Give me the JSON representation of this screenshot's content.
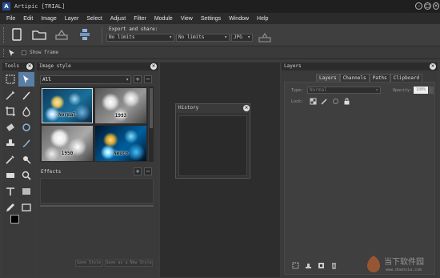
{
  "app": {
    "title": "Artipic [TRIAL]",
    "logo_letter": "A"
  },
  "window_controls": [
    "minimize",
    "maximize",
    "close"
  ],
  "menu": [
    "File",
    "Edit",
    "Image",
    "Layer",
    "Select",
    "Adjust",
    "Filter",
    "Module",
    "View",
    "Settings",
    "Window",
    "Help"
  ],
  "toolbar": {
    "export_label": "Export and share:",
    "export_size_1": "No limits",
    "export_size_2": "No limits",
    "export_format": "JPG"
  },
  "options_bar": {
    "show_frame": "Show frame"
  },
  "tools_panel": {
    "title": "Tools"
  },
  "image_style_panel": {
    "title": "Image style",
    "category": "All",
    "thumbnails": [
      "Normal",
      "1993",
      "1950",
      "Neuro"
    ],
    "effects_label": "Effects",
    "save_style": "Save Style",
    "save_new_style": "Save as a New Style"
  },
  "history_panel": {
    "title": "History"
  },
  "layers_panel": {
    "title": "Layers",
    "tabs": [
      "Layers",
      "Channels",
      "Paths",
      "Clipboard"
    ],
    "type_label": "Type:",
    "type_value": "Normal",
    "opacity_label": "Opacity:",
    "opacity_value": "100%",
    "lock_label": "Lock:"
  },
  "watermark": {
    "text_cn": "当下软件园",
    "text_url": "www.downxia.com"
  }
}
